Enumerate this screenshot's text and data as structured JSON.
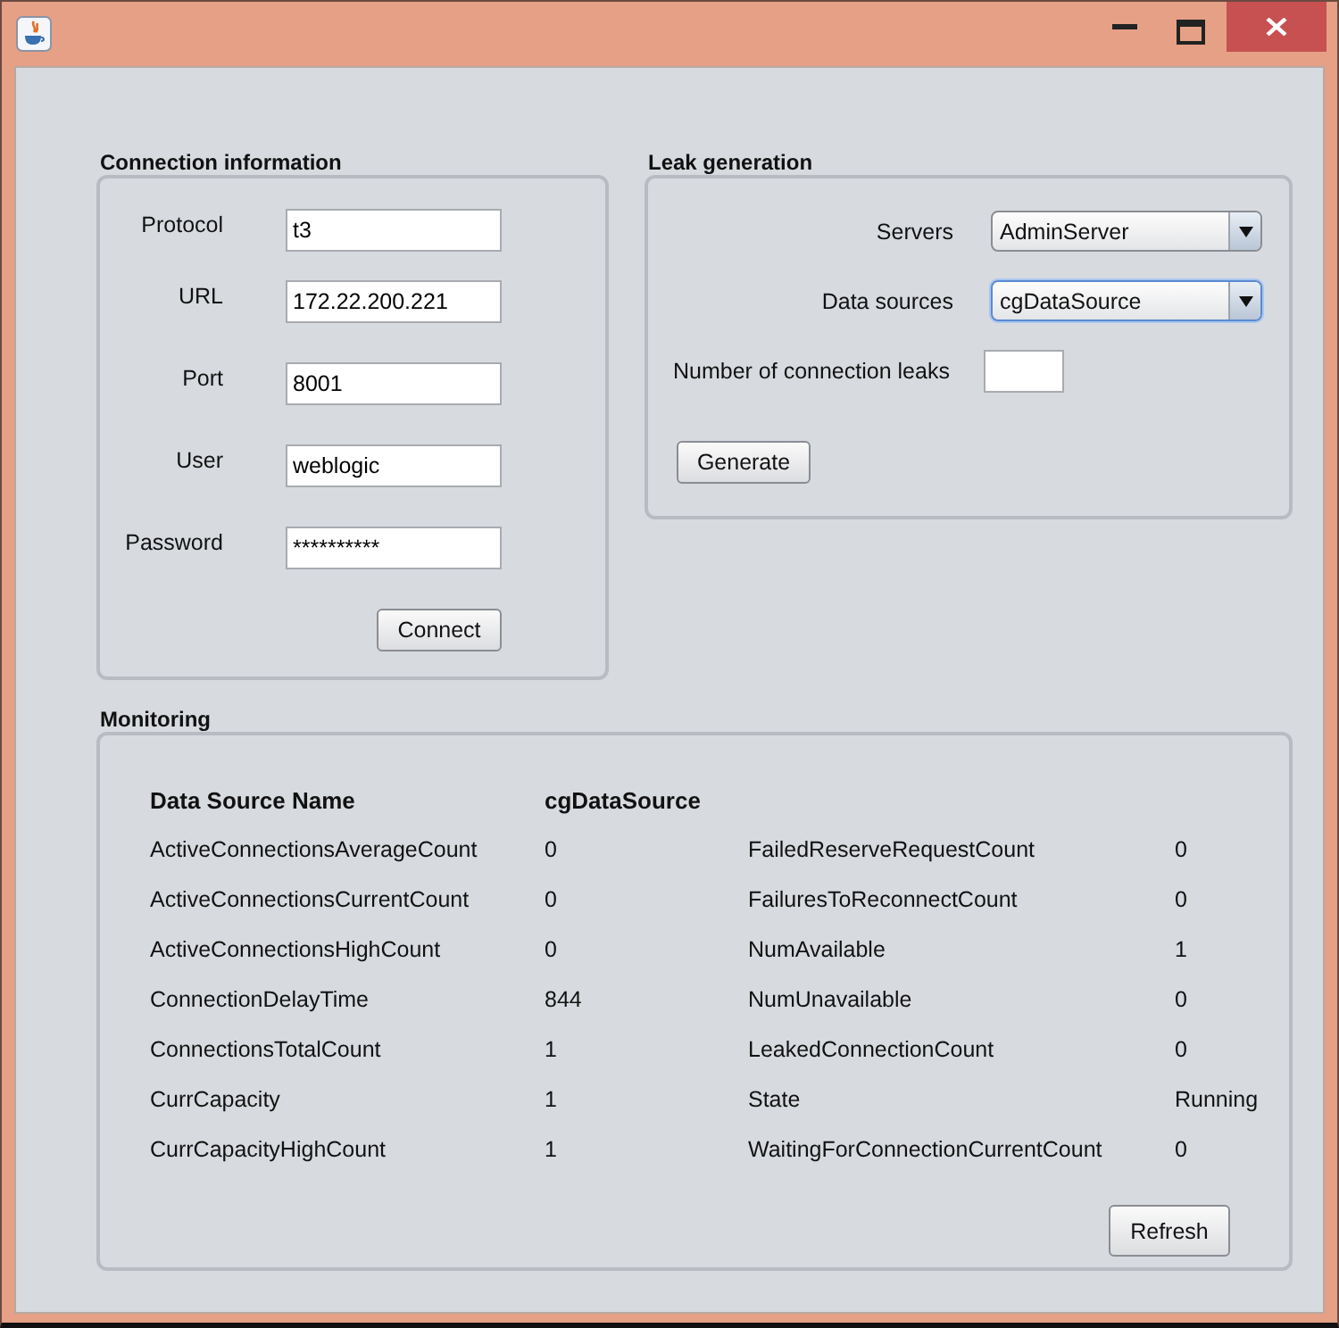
{
  "connection": {
    "title": "Connection information",
    "fields": [
      {
        "label": "Protocol",
        "value": "t3"
      },
      {
        "label": "URL",
        "value": "172.22.200.221"
      },
      {
        "label": "Port",
        "value": "8001"
      },
      {
        "label": "User",
        "value": "weblogic"
      },
      {
        "label": "Password",
        "value": "**********"
      }
    ],
    "button": "Connect"
  },
  "leak": {
    "title": "Leak generation",
    "selects": [
      {
        "label": "Servers",
        "value": "AdminServer",
        "focused": false
      },
      {
        "label": "Data sources",
        "value": "cgDataSource",
        "focused": true
      }
    ],
    "leaks_label": "Number of connection leaks",
    "button": "Generate"
  },
  "monitoring": {
    "title": "Monitoring",
    "header": {
      "name": "Data Source Name",
      "value": "cgDataSource"
    },
    "rows": [
      {
        "name": "ActiveConnectionsAverageCount",
        "value": "0",
        "name_2": "FailedReserveRequestCount",
        "value_2": "0"
      },
      {
        "name": "ActiveConnectionsCurrentCount",
        "value": "0",
        "name_2": "FailuresToReconnectCount",
        "value_2": "0"
      },
      {
        "name": "ActiveConnectionsHighCount",
        "value": "0",
        "name_2": "NumAvailable",
        "value_2": "1"
      },
      {
        "name": "ConnectionDelayTime",
        "value": "844",
        "name_2": "NumUnavailable",
        "value_2": "0"
      },
      {
        "name": "ConnectionsTotalCount",
        "value": "1",
        "name_2": "LeakedConnectionCount",
        "value_2": "0"
      },
      {
        "name": "CurrCapacity",
        "value": "1",
        "name_2": "State",
        "value_2": "Running"
      },
      {
        "name": "CurrCapacityHighCount",
        "value": "1",
        "name_2": "WaitingForConnectionCurrentCount",
        "value_2": "0"
      }
    ],
    "button": "Refresh"
  }
}
